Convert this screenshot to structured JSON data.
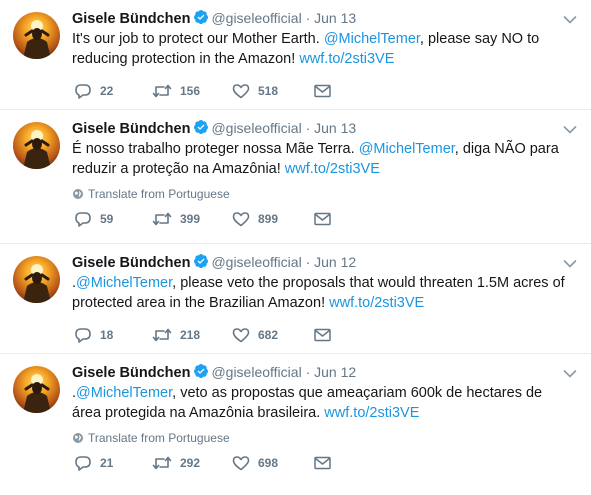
{
  "tweets": [
    {
      "name": "Gisele Bündchen",
      "handle": "@giseleofficial",
      "dot": "·",
      "date": "Jun 13",
      "text_parts": [
        "It's our job to protect our Mother Earth. ",
        "@MichelTemer",
        ", please say NO to reducing protection in the Amazon! ",
        "wwf.to/2sti3VE"
      ],
      "translate": "",
      "replies": "22",
      "retweets": "156",
      "likes": "518"
    },
    {
      "name": "Gisele Bündchen",
      "handle": "@giseleofficial",
      "dot": "·",
      "date": "Jun 13",
      "text_parts": [
        "É nosso trabalho proteger nossa Mãe Terra. ",
        "@MichelTemer",
        ", diga NÃO para reduzir a proteção na Amazônia! ",
        "wwf.to/2sti3VE"
      ],
      "translate": "Translate from Portuguese",
      "replies": "59",
      "retweets": "399",
      "likes": "899"
    },
    {
      "name": "Gisele Bündchen",
      "handle": "@giseleofficial",
      "dot": "·",
      "date": "Jun 12",
      "text_parts": [
        ".",
        "@MichelTemer",
        ", please veto the proposals that would threaten 1.5M acres of protected area in the Brazilian Amazon! ",
        "wwf.to/2sti3VE"
      ],
      "translate": "",
      "replies": "18",
      "retweets": "218",
      "likes": "682"
    },
    {
      "name": "Gisele Bündchen",
      "handle": "@giseleofficial",
      "dot": "·",
      "date": "Jun 12",
      "text_parts": [
        ".",
        "@MichelTemer",
        ", veto as propostas que ameaçariam 600k de hectares de área protegida na Amazônia brasileira. ",
        "wwf.to/2sti3VE"
      ],
      "translate": "Translate from Portuguese",
      "replies": "21",
      "retweets": "292",
      "likes": "698"
    }
  ],
  "colors": {
    "accent": "#1b95e0",
    "verified": "#1da1f2",
    "muted": "#657786",
    "text": "#14171a",
    "divider": "#e6ecf0"
  },
  "icons": [
    "verified-badge-icon",
    "chevron-down-icon",
    "globe-icon",
    "reply-icon",
    "retweet-icon",
    "like-icon",
    "direct-message-icon"
  ]
}
